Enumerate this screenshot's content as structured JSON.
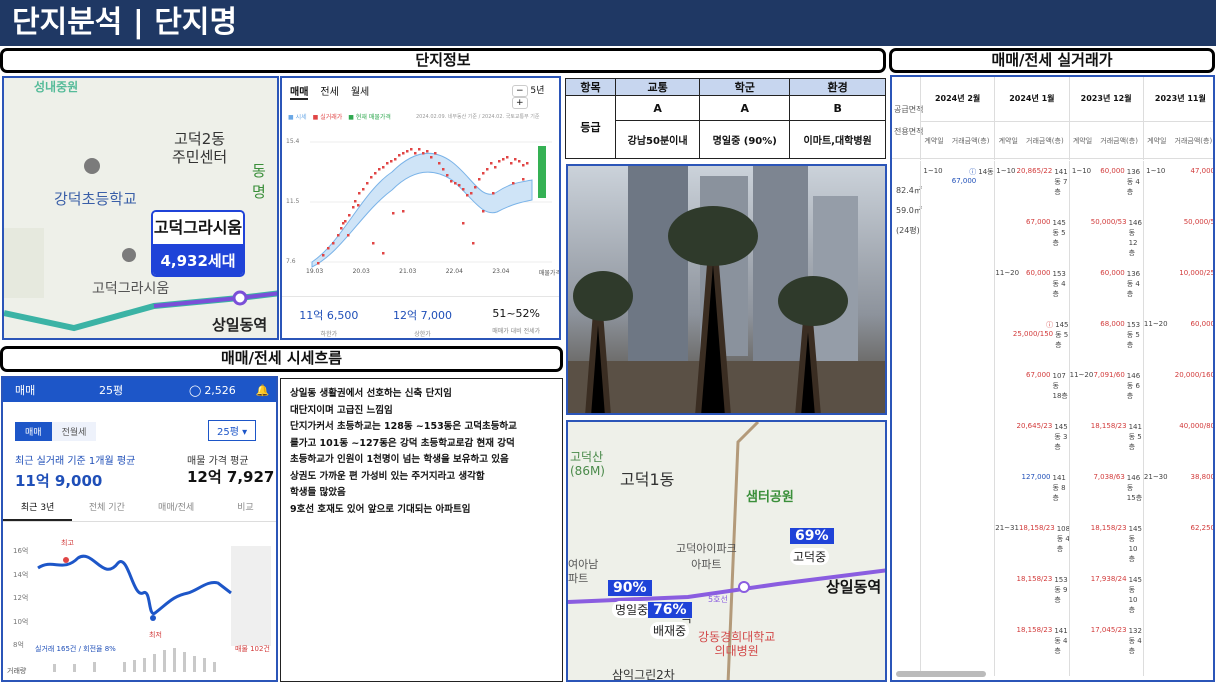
{
  "header": {
    "title": "단지분석 | 단지명"
  },
  "sections": {
    "info": "단지정보",
    "deals": "매매/전세 실거래가",
    "trend": "매매/전세 시세흐름"
  },
  "map1": {
    "labels": [
      "고덕2동",
      "주민센터",
      "동명",
      "강덕초등학교",
      "고덕그라시움",
      "상일동역"
    ],
    "top_label": "성내중원",
    "complex_name": "고덕그라시움",
    "households": "4,932세대",
    "line_label": "5"
  },
  "price_widget": {
    "tabs": [
      "매매",
      "전세",
      "월세"
    ],
    "period": "5년",
    "legend": [
      "시세",
      "실거래가",
      "현재 매물가격"
    ],
    "source": "2024.02.09. 네부동산 기준 / 2024.02. 국토교통부 기준",
    "y_ticks": [
      "15.4",
      "11.5",
      "7.6"
    ],
    "x_ticks": [
      "19.03",
      "20.03",
      "21.03",
      "22.04",
      "23.04",
      "매물가격"
    ],
    "low_value": "11억 6,500",
    "low_label": "하한가",
    "high_value": "12억 7,000",
    "high_label": "상한가",
    "ratio_value": "51~52%",
    "ratio_label": "매매가 대비 전세가"
  },
  "grade_table": {
    "headers": [
      "항목",
      "교통",
      "학군",
      "환경"
    ],
    "row_label": "등급",
    "grades": [
      "A",
      "A",
      "B"
    ],
    "details": [
      "강남50분이내",
      "명일중 (90%)",
      "이마트,대학병원"
    ]
  },
  "map2": {
    "labels": [
      "고덕산",
      "(86M)",
      "고덕1동",
      "샘터공원",
      "고덕아이파크",
      "아파트",
      "상일동역",
      "명일중",
      "배재중",
      "고덕중",
      "강동경희대학교",
      "의대병원",
      "삼익그린2차",
      "여아남",
      "파트",
      "5호선",
      "역"
    ],
    "flags": [
      "90%",
      "76%",
      "69%"
    ]
  },
  "trend_widget": {
    "type": "매매",
    "area": "25평",
    "comments": "2,526",
    "toggle": [
      "매매",
      "전월세"
    ],
    "area_select": "25평",
    "recent_label": "최근 실거래 기준 1개월 평균",
    "recent_value": "11억 9,000",
    "listing_label": "매물 가격 평균",
    "listing_value": "12억 7,927",
    "tabs": [
      "최근 3년",
      "전체 기간",
      "매매/전세",
      "비교"
    ],
    "y_ticks": [
      "16억",
      "14억",
      "12억",
      "10억",
      "8억"
    ],
    "high_tag": "최고",
    "low_tag": "최저",
    "footer_left": "실거래 165건 / 회전율 8%",
    "footer_right": "매물 102건",
    "volume_label": "거래량"
  },
  "description": {
    "lines": [
      "상일동 생활권에서 선호하는 신축 단지임",
      "대단지이며 고급진 느낌임",
      "단지가커서 초등하교는 128동 ~153동은 고덕초등하교",
      "를가고 101동 ~127동은 강덕 초등학교로감 현재 강덕",
      "초등하교가 인원이 1천명이 넘는 학생을 보유하고 있음",
      "상권도 가까운 편 가성비 있는 주거지라고 생각함",
      "학생들 많았음",
      "9호선 호재도 있어 앞으로 기대되는 아파트임"
    ]
  },
  "deal_table": {
    "left_headers": [
      "공급면적",
      "전용면적"
    ],
    "left_values": [
      "82.4㎡",
      "59.0㎡",
      "(24평)"
    ],
    "months": [
      "2024년 2월",
      "2024년 1월",
      "2023년 12월",
      "2023년 11월"
    ],
    "sub_headers": [
      "계약일",
      "거래금액(층)"
    ],
    "col1": [
      {
        "d": "1~10",
        "p": "ⓘ 67,000",
        "f": "14동",
        "c": "blue"
      }
    ],
    "col2": [
      {
        "d": "1~10",
        "p": "20,865/22",
        "f": "141동 7층",
        "c": "red"
      },
      {
        "d": "",
        "p": "67,000",
        "f": "145동 5층",
        "c": "red"
      },
      {
        "d": "11~20",
        "p": "60,000",
        "f": "153동 4층",
        "c": "red"
      },
      {
        "d": "",
        "p": "ⓘ 25,000/150",
        "f": "145동 5층",
        "c": "red"
      },
      {
        "d": "",
        "p": "67,000",
        "f": "107동 18층",
        "c": "red"
      },
      {
        "d": "",
        "p": "20,645/23",
        "f": "145동 3층",
        "c": "red"
      },
      {
        "d": "",
        "p": "127,000",
        "f": "141동 8층",
        "c": "blue"
      },
      {
        "d": "21~31",
        "p": "18,158/23",
        "f": "108동 4층",
        "c": "red"
      },
      {
        "d": "",
        "p": "18,158/23",
        "f": "153동 9층",
        "c": "red"
      },
      {
        "d": "",
        "p": "18,158/23",
        "f": "141동 4층",
        "c": "red"
      }
    ],
    "col3": [
      {
        "d": "1~10",
        "p": "60,000",
        "f": "136동 4층",
        "c": "red"
      },
      {
        "d": "",
        "p": "50,000/53",
        "f": "146동 12층",
        "c": "red"
      },
      {
        "d": "",
        "p": "60,000",
        "f": "136동 4층",
        "c": "red"
      },
      {
        "d": "",
        "p": "68,000",
        "f": "153동 5층",
        "c": "red"
      },
      {
        "d": "11~20",
        "p": "7,091/60",
        "f": "146동 6층",
        "c": "red"
      },
      {
        "d": "",
        "p": "18,158/23",
        "f": "141동 5층",
        "c": "red"
      },
      {
        "d": "",
        "p": "7,038/63",
        "f": "146동 15층",
        "c": "red"
      },
      {
        "d": "",
        "p": "18,158/23",
        "f": "145동 10층",
        "c": "red"
      },
      {
        "d": "",
        "p": "17,938/24",
        "f": "145동 10층",
        "c": "red"
      },
      {
        "d": "",
        "p": "17,045/23",
        "f": "132동 4층",
        "c": "red"
      }
    ],
    "col4": [
      {
        "d": "1~10",
        "p": "47,000",
        "c": "red"
      },
      {
        "d": "",
        "p": "50,000/5",
        "c": "red"
      },
      {
        "d": "",
        "p": "10,000/25",
        "c": "red"
      },
      {
        "d": "11~20",
        "p": "60,000",
        "c": "red"
      },
      {
        "d": "",
        "p": "20,000/160",
        "c": "red"
      },
      {
        "d": "",
        "p": "40,000/80",
        "c": "red"
      },
      {
        "d": "21~30",
        "p": "38,800",
        "c": "red"
      },
      {
        "d": "",
        "p": "62,250",
        "c": "red"
      }
    ]
  }
}
